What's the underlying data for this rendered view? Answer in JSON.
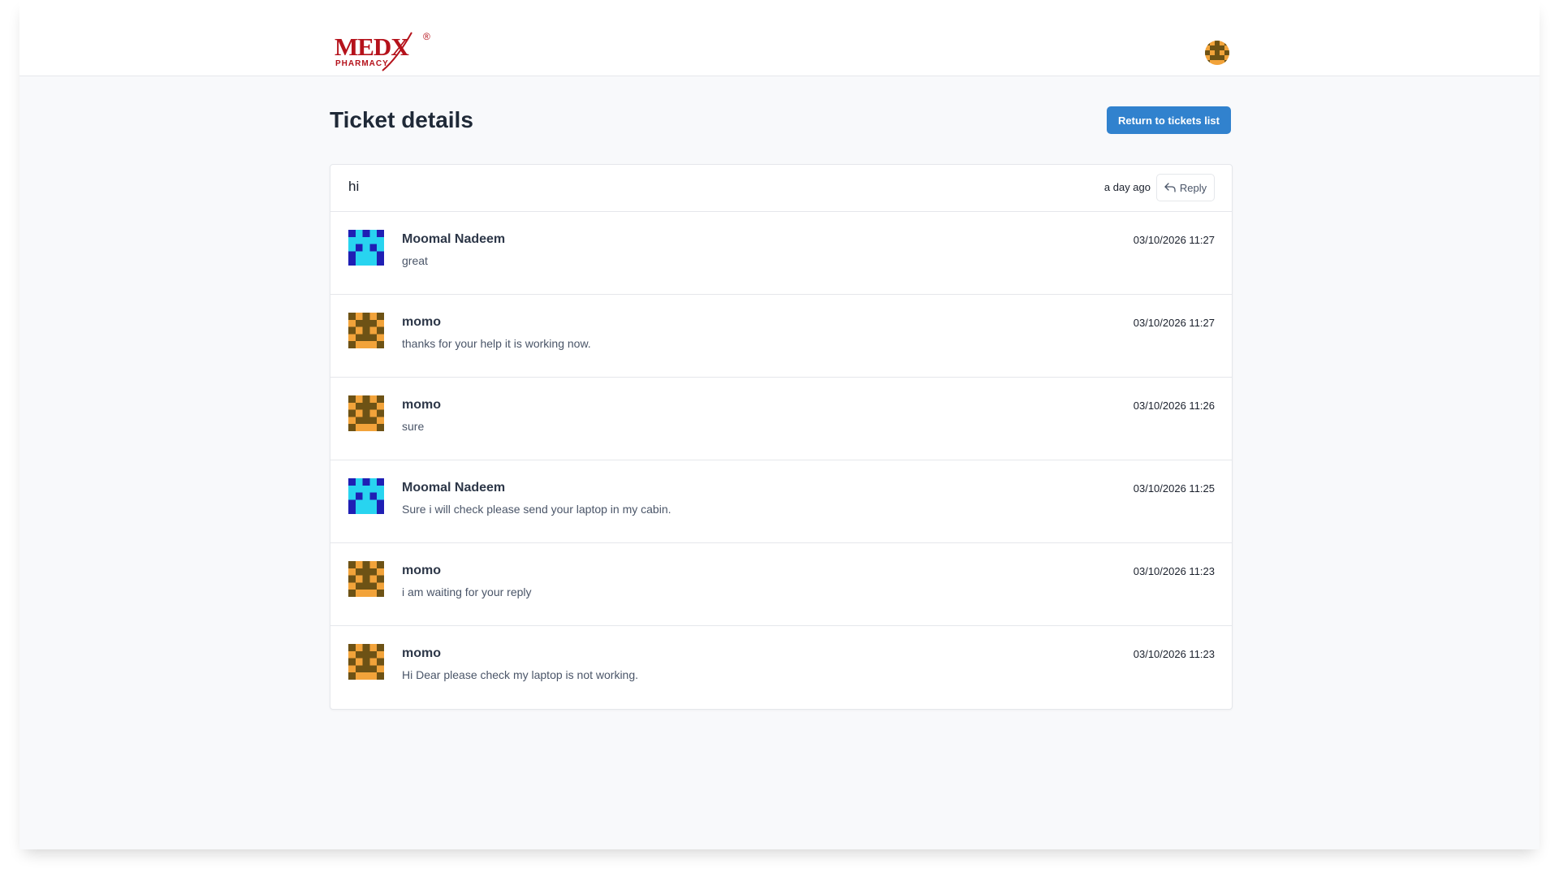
{
  "brand": {
    "logo_main": "MEDX",
    "logo_sub": "PHARMACY",
    "logo_mark": "®",
    "color": "#b5121b"
  },
  "page": {
    "title": "Ticket details",
    "return_label": "Return to tickets list",
    "accent": "#3182ce"
  },
  "ticket": {
    "subject": "hi",
    "age": "a day ago",
    "reply_label": "Reply",
    "reply_icon": "reply-icon"
  },
  "messages": [
    {
      "author": "Moomal Nadeem",
      "text": "great",
      "time": "03/10/2026 11:27",
      "avatar": "blue-identicon"
    },
    {
      "author": "momo",
      "text": "thanks for your help it is working now.",
      "time": "03/10/2026 11:27",
      "avatar": "orange-identicon"
    },
    {
      "author": "momo",
      "text": "sure",
      "time": "03/10/2026 11:26",
      "avatar": "orange-identicon"
    },
    {
      "author": "Moomal Nadeem",
      "text": "Sure i will check please send your laptop in my cabin.",
      "time": "03/10/2026 11:25",
      "avatar": "blue-identicon"
    },
    {
      "author": "momo",
      "text": "i am waiting for your reply",
      "time": "03/10/2026 11:23",
      "avatar": "orange-identicon"
    },
    {
      "author": "momo",
      "text": "Hi Dear please check my laptop is not working.",
      "time": "03/10/2026 11:23",
      "avatar": "orange-identicon"
    }
  ]
}
